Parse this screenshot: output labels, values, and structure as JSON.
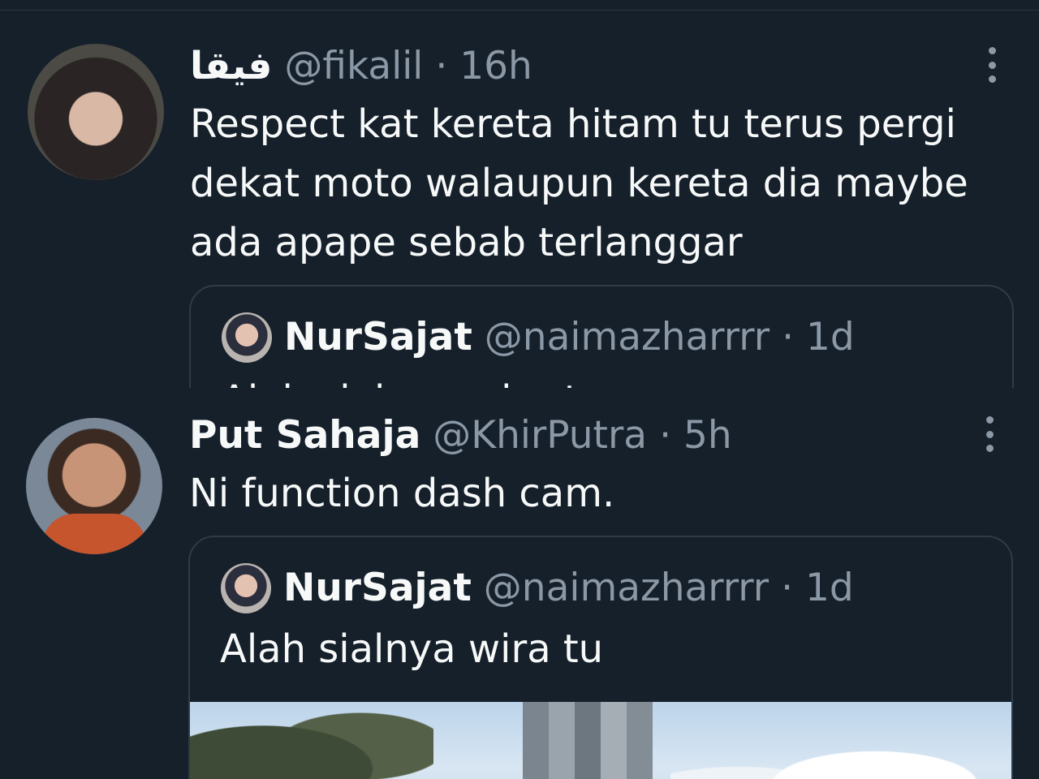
{
  "tweets": [
    {
      "display_name": "فيقا",
      "handle": "@fikalil",
      "time": "· 16h",
      "text_lines": [
        "Respect kat kereta hitam tu terus pergi",
        "dekat moto walaupun kereta dia maybe",
        "ada apape sebab terlanggar"
      ],
      "quote": {
        "display_name": "NurSajat",
        "handle": "@naimazharrrr",
        "time": "· 1d",
        "text": "Alah sialnya wira tu"
      }
    },
    {
      "display_name": "Put Sahaja",
      "handle": "@KhirPutra",
      "time": "· 5h",
      "text_lines": [
        "Ni function dash cam."
      ],
      "quote": {
        "display_name": "NurSajat",
        "handle": "@naimazharrrr",
        "time": "· 1d",
        "text": "Alah sialnya wira tu"
      }
    }
  ],
  "icons": {
    "more": "more-vertical-icon",
    "avatar": "avatar-photo"
  },
  "colors": {
    "background": "#15202b",
    "text": "#f7f9f9",
    "muted": "#8b98a5",
    "border": "#2f3b47"
  }
}
